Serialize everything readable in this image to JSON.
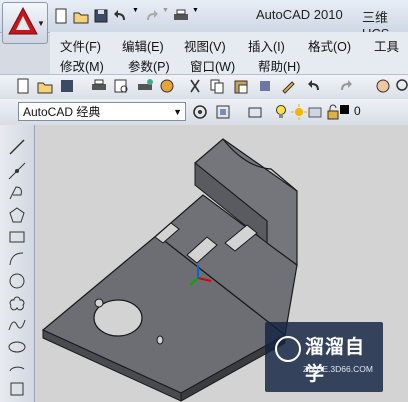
{
  "title": {
    "app": "AutoCAD 2010",
    "file": "三维UCS"
  },
  "menus_row1": [
    "文件(F)",
    "编辑(E)",
    "视图(V)",
    "插入(I)",
    "格式(O)",
    "工具"
  ],
  "menus_row2": [
    "修改(M)",
    "参数(P)",
    "窗口(W)",
    "帮助(H)"
  ],
  "workspace": {
    "value": "AutoCAD 经典"
  },
  "layer": {
    "value": "0"
  },
  "watermark": {
    "text": "溜溜自学",
    "url": "ZIXUE.3D66.COM"
  },
  "colors": {
    "accent": "#c4161c",
    "viewport_bg": "#d3d3d3",
    "model": "#6b6d73"
  }
}
